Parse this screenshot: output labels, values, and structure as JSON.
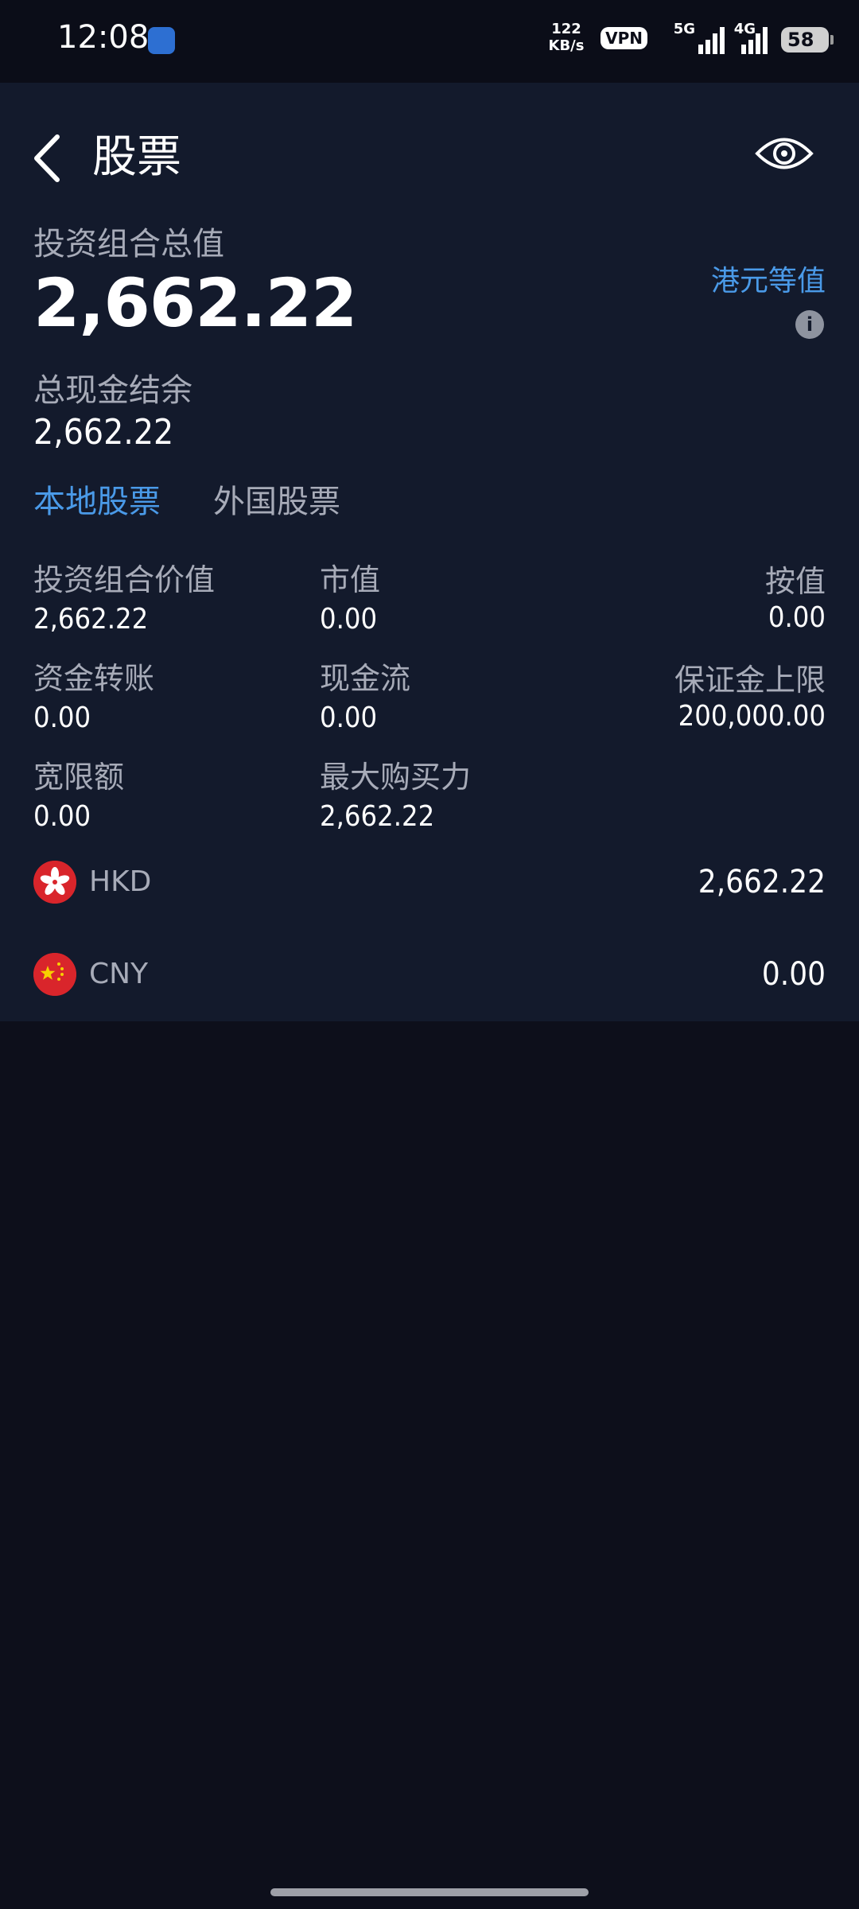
{
  "status_bar": {
    "time": "12:08",
    "speed_value": "122",
    "speed_unit": "KB/s",
    "vpn": "VPN",
    "net1": "5G",
    "net2": "4G",
    "battery": "58"
  },
  "header": {
    "title": "股票"
  },
  "portfolio": {
    "total_label": "投资组合总值",
    "total_value": "2,662.22",
    "hkd_equiv": "港元等值",
    "cash_label": "总现金结余",
    "cash_value": "2,662.22"
  },
  "tabs": [
    {
      "label": "本地股票",
      "active": true
    },
    {
      "label": "外国股票",
      "active": false
    }
  ],
  "metrics": [
    {
      "label": "投资组合价值",
      "value": "2,662.22"
    },
    {
      "label": "市值",
      "value": "0.00"
    },
    {
      "label": "按值",
      "value": "0.00"
    },
    {
      "label": "资金转账",
      "value": "0.00"
    },
    {
      "label": "现金流",
      "value": "0.00"
    },
    {
      "label": "保证金上限",
      "value": "200,000.00"
    },
    {
      "label": "宽限额",
      "value": "0.00"
    },
    {
      "label": "最大购买力",
      "value": "2,662.22"
    }
  ],
  "currencies": [
    {
      "code": "HKD",
      "amount": "2,662.22",
      "flag": "hong-kong-flag-icon"
    },
    {
      "code": "CNY",
      "amount": "0.00",
      "flag": "china-flag-icon"
    }
  ],
  "colors": {
    "background": "#0d0f1b",
    "card": "#131a2c",
    "accent": "#4a9ae8",
    "label": "#a7abb8"
  }
}
